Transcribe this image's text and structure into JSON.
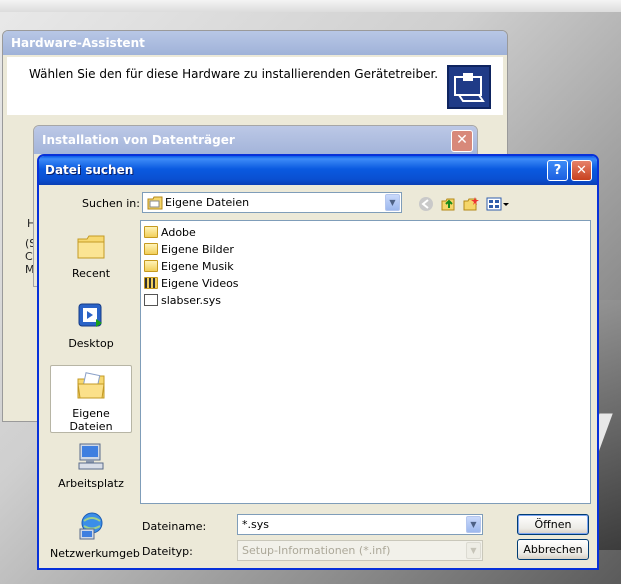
{
  "hardware_assistant": {
    "title": "Hardware-Assistent",
    "header_text": "Wählen Sie den für diese Hardware zu installierenden Gerätetreiber.",
    "fragments": [
      "H",
      "(S",
      "C:",
      "M"
    ]
  },
  "install_disk": {
    "title": "Installation von Datenträger"
  },
  "file_dialog": {
    "title": "Datei suchen",
    "look_in_label": "Suchen in:",
    "look_in_value": "Eigene Dateien",
    "places": [
      {
        "label": "Recent",
        "icon": "recent-folder-icon"
      },
      {
        "label": "Desktop",
        "icon": "desktop-icon"
      },
      {
        "label": "Eigene Dateien",
        "icon": "my-documents-icon"
      },
      {
        "label": "Arbeitsplatz",
        "icon": "my-computer-icon"
      },
      {
        "label": "Netzwerkumgeb",
        "icon": "network-icon"
      }
    ],
    "files": [
      {
        "name": "Adobe",
        "icon": "folder-icon"
      },
      {
        "name": "Eigene Bilder",
        "icon": "pictures-folder-icon"
      },
      {
        "name": "Eigene Musik",
        "icon": "music-folder-icon"
      },
      {
        "name": "Eigene Videos",
        "icon": "videos-folder-icon"
      },
      {
        "name": "slabser.sys",
        "icon": "system-file-icon"
      }
    ],
    "filename_label": "Dateiname:",
    "filename_value": "*.sys",
    "filetype_label": "Dateityp:",
    "filetype_value": "Setup-Informationen (*.inf)",
    "open_label": "Öffnen",
    "cancel_label": "Abbrechen",
    "help_glyph": "?",
    "close_glyph": "✕"
  },
  "colors": {
    "titlebar_active": "#0a5ae0",
    "titlebar_inactive": "#a3b4da",
    "dialog_face": "#ece9d8"
  }
}
